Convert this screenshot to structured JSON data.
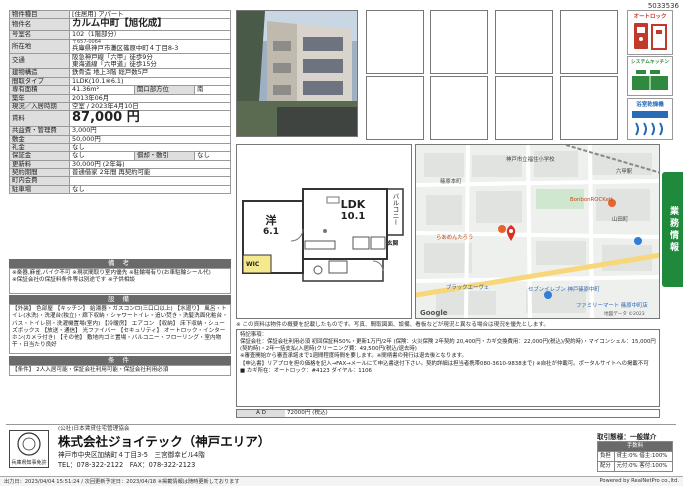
{
  "sheet_no": "5033536",
  "table_rows": [
    {
      "key": "物件種目",
      "value": "[住居用] アパート"
    },
    {
      "key": "物件名",
      "value": "カルム中町【旭化成】"
    },
    {
      "key": "号室名",
      "value": "102（1階部分）"
    },
    {
      "key": "所在地",
      "zip": "〒657-0064",
      "value": "兵庫県神戸市灘区篠原中町４丁目8-3"
    },
    {
      "key": "交通",
      "value": "阪急神戸線「六甲」徒歩9分",
      "value2": "東海道線「六甲道」徒歩15分"
    },
    {
      "key": "建物構造",
      "value": "鉄骨造 地上3階 総戸数5戸"
    },
    {
      "key": "間取タイプ",
      "value": "1LDK(10.1※6.1)"
    },
    {
      "key": "専有面積",
      "value": "41.36m²",
      "sub_key": "開口部方位",
      "sub_value": "南"
    },
    {
      "key": "築年",
      "value": "2013年06月"
    },
    {
      "key": "現況／入居時期",
      "value": "空室 / 2023年4月10日"
    },
    {
      "key": "賃料",
      "value": "87,000 円"
    },
    {
      "key": "共益費・管理費",
      "value": "3,000円"
    },
    {
      "key": "敷金",
      "value": "50,000円"
    },
    {
      "key": "礼金",
      "value": "なし"
    },
    {
      "key": "保証金",
      "value": "なし",
      "sub_key": "償却・敷引",
      "sub_value": "なし"
    },
    {
      "key": "更新料",
      "value": "30,000円 (2年毎)"
    },
    {
      "key": "契約期間",
      "value": "普通借家 2年間 再契約可能"
    },
    {
      "key": "町内会費",
      "value": ""
    },
    {
      "key": "駐車場",
      "value": "なし"
    }
  ],
  "bikou": {
    "heading": "備 考",
    "text": "※楽器,麻雀,バイク不可 ※現状間取り室内優先 ※駐輪場有り(お車駐輪シール代)",
    "text2": "※保証会社の保証料条件等は別途です ※子供相談"
  },
  "setsubi": {
    "heading": "設 備",
    "text": "【外装】 色部屋 【キッチン】 給湯器・ガスコンロ(三口口以上) 【水廻り】 風呂・トイレ(水洗)・洗濯台(独立)・廊下収納・シャワートイレ・追い焚き・洗髪洗面化粧台・バス・トイレ別・洗濯機置場(室内) 【冷暖房】 エアコン 【収納】 床下収納・シューズボックス 【放送・通信】 光ファイバー 【セキュリティ】 オートロック・インターホン(カメラ付き) 【その他】 敷地内ゴミ置場・バルコニー・フローリング・室内物干・日当たり良好"
  },
  "jouken": {
    "heading": "条 件",
    "text": "【条件】 2人入居可能・保証会社利用可能・保証会社利用必須"
  },
  "icons": [
    {
      "label": "オートロック",
      "color": "#c0392b"
    },
    {
      "label": "システムキッチン",
      "color": "#2f8a3f"
    },
    {
      "label": "浴室乾燥機",
      "color": "#2a6bb5"
    }
  ],
  "side_tab": "業務情報",
  "floor_plan": {
    "room1_name": "洋",
    "room1_size": "6.1",
    "room2_name": "LDK",
    "room2_size": "10.1",
    "wic": "WIC",
    "balcony": "バルコニー",
    "entrance": "玄関"
  },
  "map": {
    "labels": [
      "篠原本町",
      "BonbonROCKett",
      "らあめんたろう",
      "ブラックエーヴェ",
      "セブンイレブン 神戸篠原中町",
      "ファミリーマート 篠原中町店",
      "六甲駅",
      "神戸市立福住小学校",
      "山田町"
    ],
    "google": "Google",
    "copyright": "地図データ ©2023"
  },
  "map_note": "※ この資料は物件の概要を記載したものです。写真、間取図面、設備、看板などが現況と異なる場合は現況を優先とします。",
  "remarks": {
    "label": "特記事項：",
    "lines": [
      "保証会社：保証会社利用必須 初回保証料50%・更新1万円/2年 (保険：火災保険 2年契約 20,400円・カギ交換費用：22,000円(税込)/契約時)・マイコンシェル：15,000円(契約時)・2年一括支払(入居時)クリーニング費：49,500円(税込/退去時)",
      "※審査開始から審査承諾まで1週間程度時間を要します。※間柄書の発行は退去後となります。",
      "【申込書】リアプロを担の価格を記入→FAX→メールにて申込書送付下さい。契約詳細は担当者携帯080-3610-9838まで) ※自社が仲載可。ポータルサイトへの掲載不可",
      "■ カギ所在：オートロック：#4123 ダイヤル：1106"
    ]
  },
  "ad": {
    "label": "A D",
    "value": "72000円 (税込)"
  },
  "company": {
    "cert_text": "兵庫県知事免許",
    "sub": "(公社)日本賃貸住宅管理協会",
    "name": "株式会社ジョイテック（神戸エリア）",
    "address": "神戸市中央区加納町４丁目3-5　三宮御幸ビル4階",
    "tel": "TEL：078-322-2122　FAX：078-322-2123"
  },
  "deal": {
    "title": "取引態様：一般媒介",
    "fee_head": "手数料",
    "rows": [
      {
        "k": "負担",
        "v": "貸主:0% 借主:100%"
      },
      {
        "k": "配分",
        "v": "元付:0% 客付:100%"
      }
    ]
  },
  "footer": {
    "left": "出力日：2023/04/04 15:51:24 / 次回更新予定日：2023/04/18 ※掲載情報は随時更新しております",
    "right": "Powered by RealNetPro co.,ltd."
  }
}
